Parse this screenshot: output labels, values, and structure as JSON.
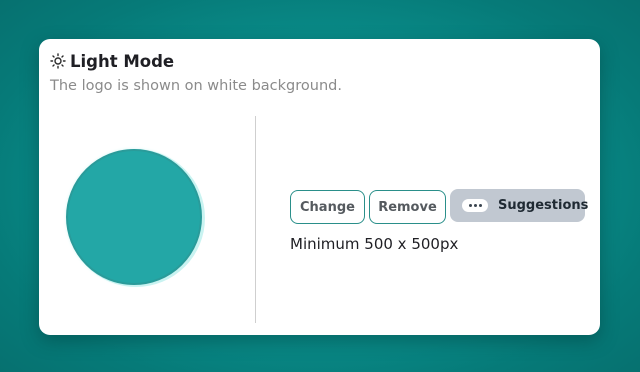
{
  "header": {
    "icon": "sun-icon",
    "title": "Light Mode",
    "subtitle": "The logo is shown on white background."
  },
  "preview": {
    "fill_color": "#23a7a6",
    "border_color": "#2a9b9a"
  },
  "actions": {
    "change_label": "Change",
    "remove_label": "Remove",
    "suggestions_label": "Suggestions",
    "suggestions_icon": "ellipsis-pill-icon"
  },
  "requirements": {
    "min_size_text": "Minimum 500 x 500px"
  },
  "colors": {
    "background_teal": "#0a8f8c",
    "card": "#ffffff",
    "accent_border": "#2a8f8a",
    "suggestions_bg": "#c1c8d1"
  }
}
